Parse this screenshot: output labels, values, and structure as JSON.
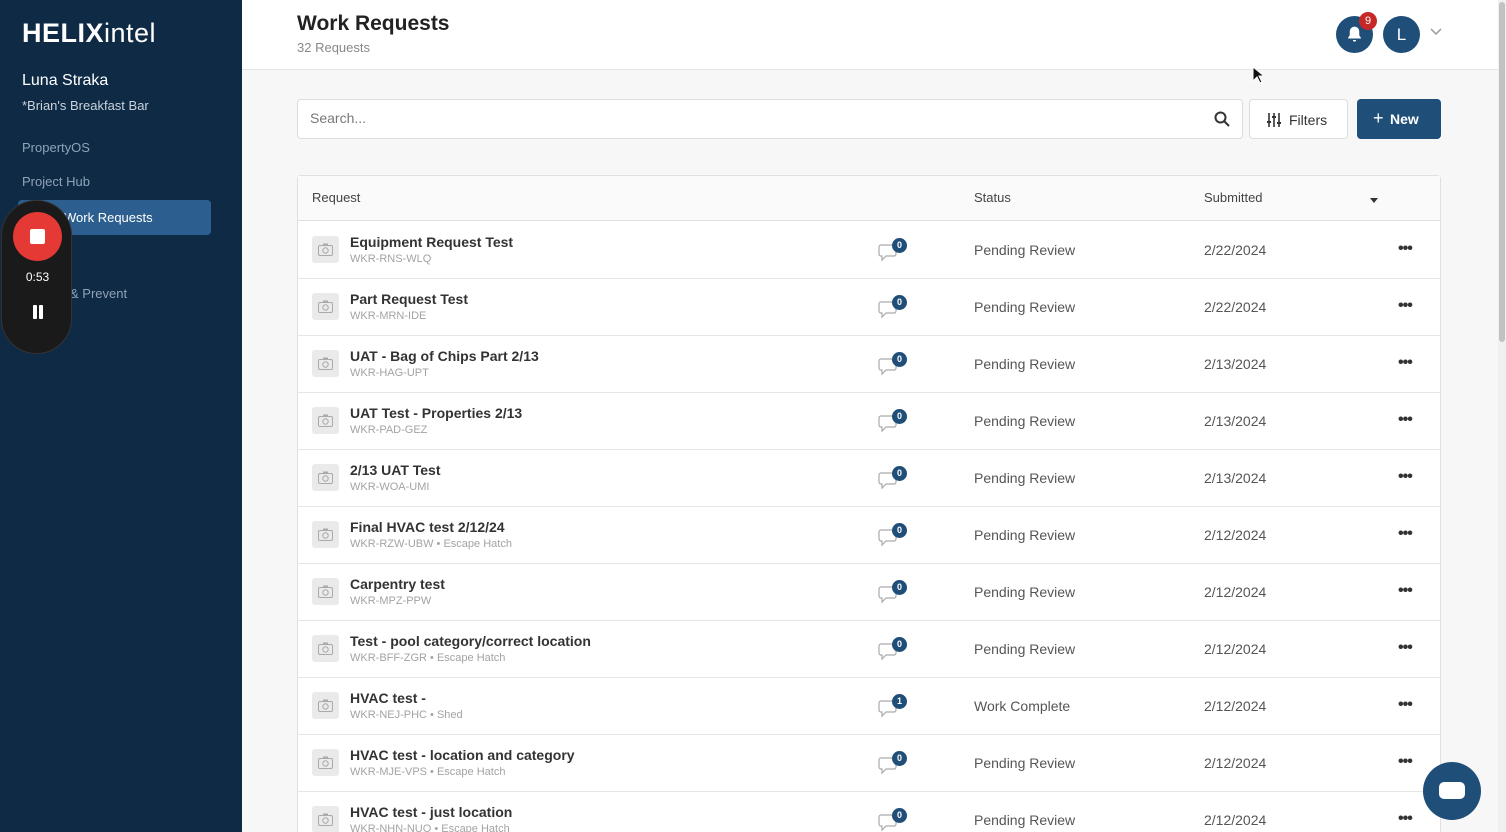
{
  "sidebar": {
    "logo_bold": "HELIX",
    "logo_light": "intel",
    "user_name": "Luna Straka",
    "user_org": "*Brian's Breakfast Bar",
    "items": [
      {
        "label": "PropertyOS"
      },
      {
        "label": "Project Hub"
      },
      {
        "label": "Work Requests"
      },
      {
        "label": "& Prevent"
      }
    ]
  },
  "recorder": {
    "time": "0:53"
  },
  "header": {
    "title": "Work Requests",
    "count": "32 Requests",
    "notification_count": "9",
    "avatar_initial": "L"
  },
  "toolbar": {
    "search_placeholder": "Search...",
    "filters_label": "Filters",
    "new_label": "New"
  },
  "table": {
    "headers": {
      "request": "Request",
      "status": "Status",
      "submitted": "Submitted"
    },
    "rows": [
      {
        "title": "Equipment Request Test",
        "sub": "WKR-RNS-WLQ",
        "comments": "0",
        "status": "Pending Review",
        "date": "2/22/2024"
      },
      {
        "title": "Part Request Test",
        "sub": "WKR-MRN-IDE",
        "comments": "0",
        "status": "Pending Review",
        "date": "2/22/2024"
      },
      {
        "title": "UAT - Bag of Chips Part 2/13",
        "sub": "WKR-HAG-UPT",
        "comments": "0",
        "status": "Pending Review",
        "date": "2/13/2024"
      },
      {
        "title": "UAT Test - Properties 2/13",
        "sub": "WKR-PAD-GEZ",
        "comments": "0",
        "status": "Pending Review",
        "date": "2/13/2024"
      },
      {
        "title": "2/13 UAT Test",
        "sub": "WKR-WOA-UMI",
        "comments": "0",
        "status": "Pending Review",
        "date": "2/13/2024"
      },
      {
        "title": "Final HVAC test 2/12/24",
        "sub": "WKR-RZW-UBW • Escape Hatch",
        "comments": "0",
        "status": "Pending Review",
        "date": "2/12/2024"
      },
      {
        "title": "Carpentry test",
        "sub": "WKR-MPZ-PPW",
        "comments": "0",
        "status": "Pending Review",
        "date": "2/12/2024"
      },
      {
        "title": "Test - pool category/correct location",
        "sub": "WKR-BFF-ZGR • Escape Hatch",
        "comments": "0",
        "status": "Pending Review",
        "date": "2/12/2024"
      },
      {
        "title": "HVAC test -",
        "sub": "WKR-NEJ-PHC • Shed",
        "comments": "1",
        "status": "Work Complete",
        "date": "2/12/2024"
      },
      {
        "title": "HVAC test - location and category",
        "sub": "WKR-MJE-VPS • Escape Hatch",
        "comments": "0",
        "status": "Pending Review",
        "date": "2/12/2024"
      },
      {
        "title": "HVAC test - just location",
        "sub": "WKR-NHN-NUO • Escape Hatch",
        "comments": "0",
        "status": "Pending Review",
        "date": "2/12/2024"
      }
    ]
  }
}
